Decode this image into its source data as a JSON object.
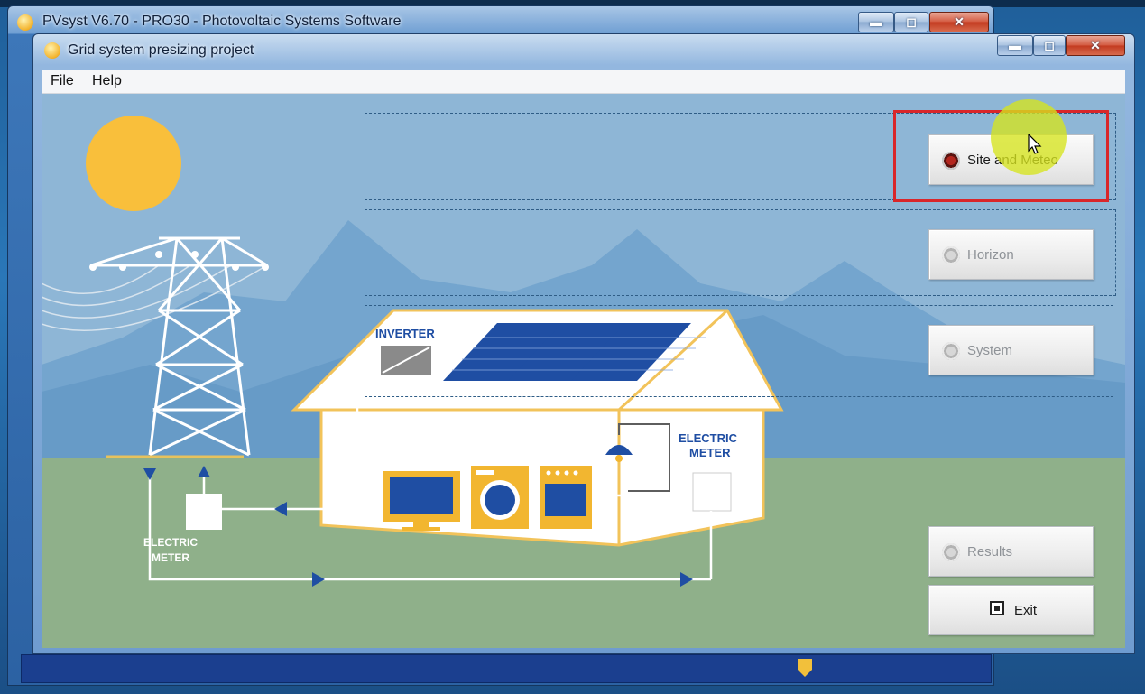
{
  "outer_window": {
    "title": "PVsyst V6.70 - PRO30 - Photovoltaic Systems Software",
    "minimize_glyph": "▬",
    "maximize_glyph": "◻",
    "close_glyph": "✕"
  },
  "inner_window": {
    "title": "Grid system presizing project",
    "minimize_glyph": "▬",
    "maximize_glyph": "◻",
    "close_glyph": "✕"
  },
  "menu": {
    "file": "File",
    "help": "Help"
  },
  "buttons": {
    "site_meteo": "Site and Meteo",
    "horizon": "Horizon",
    "system": "System",
    "results": "Results",
    "exit": "Exit"
  },
  "illustration": {
    "inverter_label": "INVERTER",
    "meter_right_label_1": "ELECTRIC",
    "meter_right_label_2": "METER",
    "meter_left_label_1": "ELECTRIC",
    "meter_left_label_2": "METER"
  },
  "colors": {
    "highlight": "#d9262a",
    "sun": "#f9bf3b",
    "sky": "#8eb6d6",
    "ground": "#8fb08a",
    "panel": "#1f4ea3",
    "appliance_yellow": "#f2b630"
  },
  "icons": {
    "app": "pvsyst-sun-icon",
    "cursor": "mouse-pointer-icon",
    "radio": "radio-button-icon",
    "exit": "exit-square-icon"
  }
}
